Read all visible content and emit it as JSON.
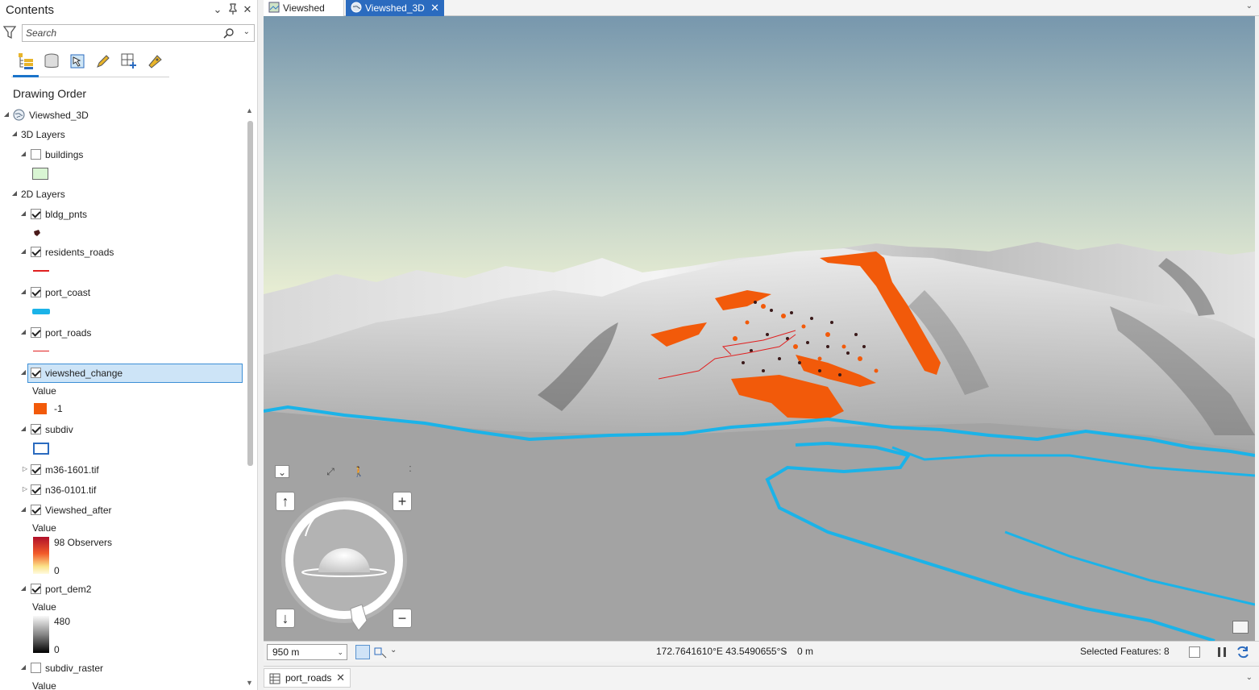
{
  "contents": {
    "title": "Contents",
    "search_placeholder": "Search",
    "drawing_order": "Drawing Order",
    "view_tabs": [
      "list-by-drawing-order-icon",
      "list-by-data-source-icon",
      "list-by-selection-icon",
      "list-by-editing-icon",
      "list-by-snapping-icon",
      "list-by-labeling-icon"
    ]
  },
  "tree": {
    "map": "Viewshed_3D",
    "group_3d": "3D Layers",
    "buildings": "buildings",
    "group_2d": "2D Layers",
    "bldg_pnts": "bldg_pnts",
    "residents_roads": "residents_roads",
    "port_coast": "port_coast",
    "port_roads": "port_roads",
    "viewshed_change": "viewshed_change",
    "viewshed_change_value": "Value",
    "viewshed_change_class": "-1",
    "subdiv": "subdiv",
    "m36": "m36-1601.tif",
    "n36": "n36-0101.tif",
    "viewshed_after": "Viewshed_after",
    "viewshed_after_value": "Value",
    "viewshed_after_high": "98 Observers",
    "viewshed_after_low": "0",
    "port_dem2": "port_dem2",
    "port_dem2_value": "Value",
    "port_dem2_high": "480",
    "port_dem2_low": "0",
    "subdiv_raster": "subdiv_raster",
    "subdiv_raster_value": "Value"
  },
  "map_tabs": {
    "tab1": "Viewshed",
    "tab2": "Viewshed_3D"
  },
  "status": {
    "scale": "950 m",
    "coordinates": "172.7641610°E 43.5490655°S",
    "elevation": "0 m",
    "selected_features": "Selected Features: 8"
  },
  "bottom_tab": "port_roads",
  "colors": {
    "accent": "#2b6bbf",
    "viewshed_change": "#f25a0a",
    "port_coast": "#1bb3e8",
    "roads": "#e02020"
  }
}
